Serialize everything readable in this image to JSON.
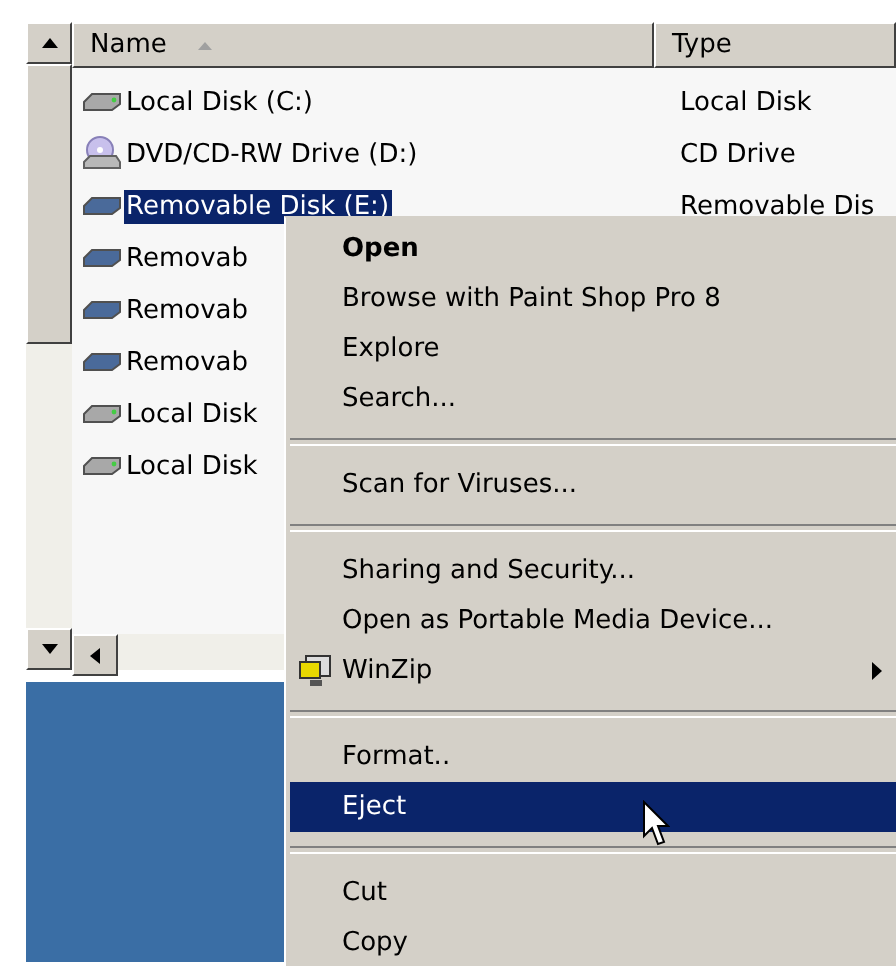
{
  "columns": [
    {
      "label": "Name",
      "sorted": true
    },
    {
      "label": "Type",
      "sorted": false
    }
  ],
  "rows": [
    {
      "kind": "disk",
      "name": "Local Disk (C:)",
      "type": "Local Disk",
      "selected": false
    },
    {
      "kind": "cd",
      "name": "DVD/CD-RW Drive (D:)",
      "type": "CD Drive",
      "selected": false
    },
    {
      "kind": "removable",
      "name": "Removable Disk (E:)",
      "type": "Removable Dis",
      "selected": true
    },
    {
      "kind": "removable",
      "name": "Removab",
      "selected": false
    },
    {
      "kind": "removable",
      "name": "Removab",
      "selected": false
    },
    {
      "kind": "removable",
      "name": "Removab",
      "selected": false
    },
    {
      "kind": "disk",
      "name": "Local Disk",
      "selected": false
    },
    {
      "kind": "disk",
      "name": "Local Disk",
      "selected": false
    }
  ],
  "context_menu": [
    {
      "kind": "item",
      "label": "Open",
      "bold": true,
      "selected": false
    },
    {
      "kind": "item",
      "label": "Browse with Paint Shop Pro 8",
      "selected": false
    },
    {
      "kind": "item",
      "label": "Explore",
      "selected": false
    },
    {
      "kind": "item",
      "label": "Search...",
      "selected": false
    },
    {
      "kind": "separator"
    },
    {
      "kind": "item",
      "label": "Scan for Viruses...",
      "selected": false
    },
    {
      "kind": "separator"
    },
    {
      "kind": "item",
      "label": "Sharing and Security...",
      "selected": false
    },
    {
      "kind": "item",
      "label": "Open as Portable Media Device...",
      "selected": false
    },
    {
      "kind": "submenu",
      "label": "WinZip",
      "selected": false
    },
    {
      "kind": "separator"
    },
    {
      "kind": "item",
      "label": "Format..",
      "selected": false
    },
    {
      "kind": "item",
      "label": "Eject",
      "selected": true
    },
    {
      "kind": "separator"
    },
    {
      "kind": "item",
      "label": "Cut",
      "selected": false
    },
    {
      "kind": "item",
      "label": "Copy",
      "selected": false
    }
  ]
}
